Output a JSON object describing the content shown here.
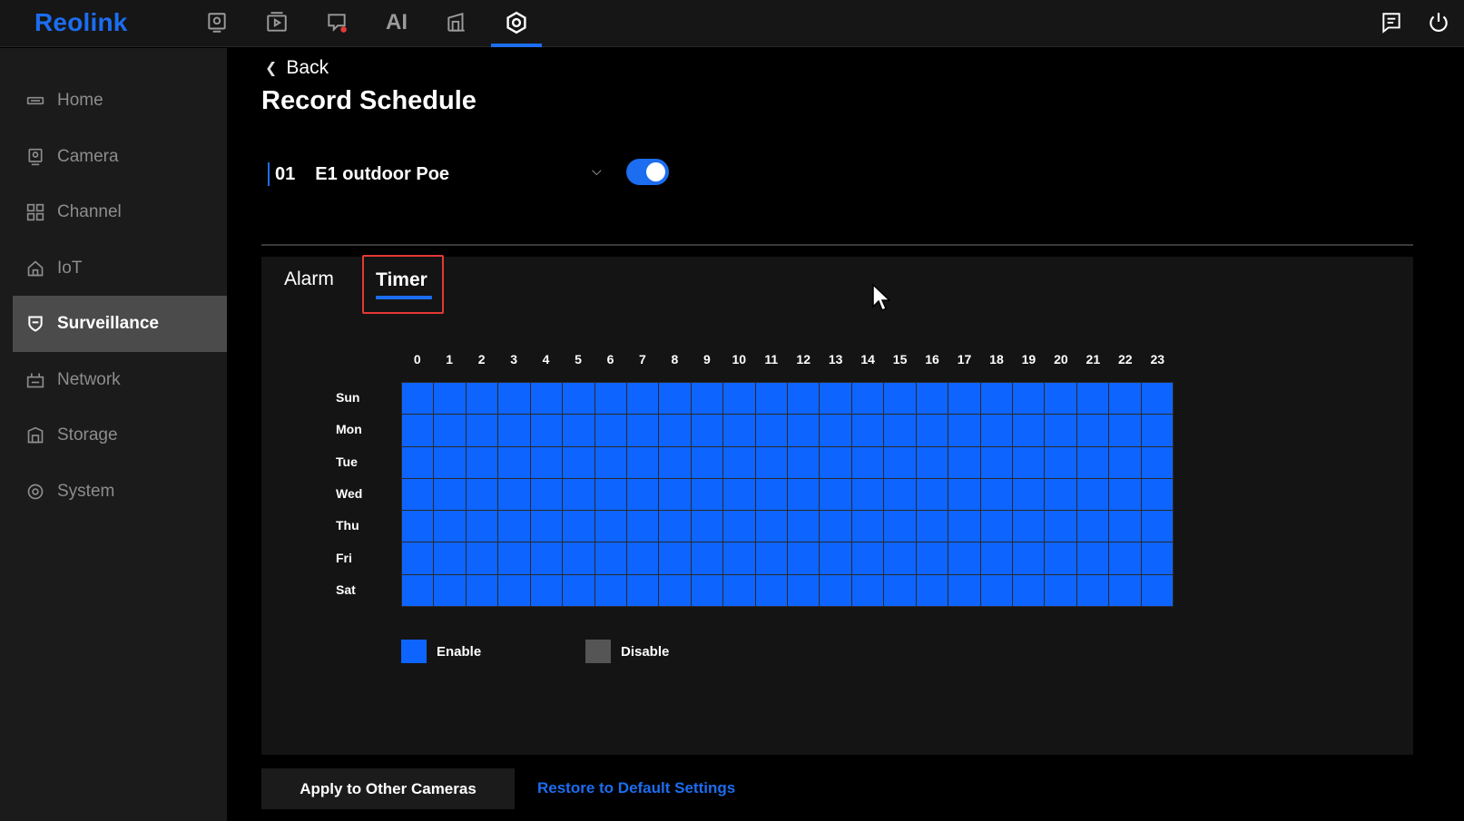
{
  "app": {
    "logo": "Reolink"
  },
  "topnav": {
    "ai_label": "AI",
    "icons": [
      "camera-preview-icon",
      "playback-icon",
      "alarm-screen-icon",
      "ai-icon",
      "tablet-icon",
      "settings-icon"
    ],
    "right_icons": [
      "message-icon",
      "power-icon"
    ],
    "active_index": 5
  },
  "sidebar": {
    "items": [
      {
        "label": "Home",
        "icon": "home-icon"
      },
      {
        "label": "Camera",
        "icon": "camera-icon"
      },
      {
        "label": "Channel",
        "icon": "channel-grid-icon"
      },
      {
        "label": "IoT",
        "icon": "iot-house-icon"
      },
      {
        "label": "Surveillance",
        "icon": "shield-icon",
        "active": true
      },
      {
        "label": "Network",
        "icon": "network-icon"
      },
      {
        "label": "Storage",
        "icon": "storage-icon"
      },
      {
        "label": "System",
        "icon": "system-gear-icon"
      }
    ]
  },
  "page": {
    "back_label": "Back",
    "title": "Record Schedule"
  },
  "camera": {
    "number": "01",
    "name": "E1 outdoor Poe",
    "enabled": true
  },
  "tabs": {
    "alarm": "Alarm",
    "timer": "Timer",
    "active": "Timer"
  },
  "schedule": {
    "hours": [
      "0",
      "1",
      "2",
      "3",
      "4",
      "5",
      "6",
      "7",
      "8",
      "9",
      "10",
      "11",
      "12",
      "13",
      "14",
      "15",
      "16",
      "17",
      "18",
      "19",
      "20",
      "21",
      "22",
      "23"
    ],
    "days": [
      "Sun",
      "Mon",
      "Tue",
      "Wed",
      "Thu",
      "Fri",
      "Sat"
    ],
    "all_enabled": true
  },
  "legend": {
    "enable": "Enable",
    "disable": "Disable",
    "enable_color": "#0d64ff",
    "disable_color": "#555555"
  },
  "footer": {
    "apply_label": "Apply to Other Cameras",
    "restore_label": "Restore to Default Settings"
  },
  "colors": {
    "accent": "#1c6df0"
  }
}
